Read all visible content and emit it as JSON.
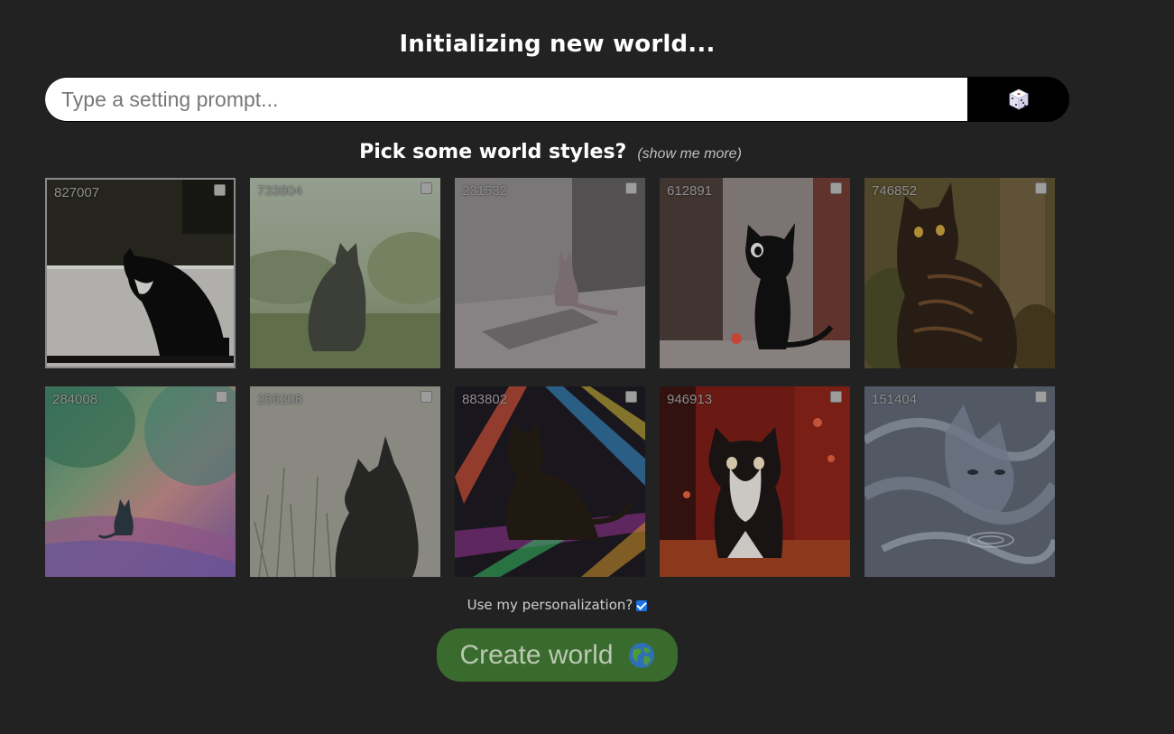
{
  "title": "Initializing new world...",
  "prompt": {
    "placeholder": "Type a setting prompt...",
    "value": ""
  },
  "styles": {
    "heading": "Pick some world styles?",
    "more_link": "(show me more)",
    "tiles": [
      {
        "id": "827007",
        "checked": false,
        "icon": "cat-silhouette-window"
      },
      {
        "id": "733804",
        "checked": false,
        "icon": "cat-meadow"
      },
      {
        "id": "231532",
        "checked": false,
        "icon": "cat-sunlit-wall"
      },
      {
        "id": "612891",
        "checked": false,
        "icon": "cat-cartoon-doorway"
      },
      {
        "id": "746852",
        "checked": false,
        "icon": "cat-forest-tabby"
      },
      {
        "id": "284008",
        "checked": false,
        "icon": "cat-rainbow-field"
      },
      {
        "id": "256208",
        "checked": false,
        "icon": "cat-grass-sketch"
      },
      {
        "id": "883802",
        "checked": false,
        "icon": "cat-neon-lights"
      },
      {
        "id": "946913",
        "checked": false,
        "icon": "cat-red-room"
      },
      {
        "id": "151404",
        "checked": false,
        "icon": "cat-smoke-swirl"
      }
    ]
  },
  "personalization": {
    "label": "Use my personalization?",
    "checked": true
  },
  "create_button": {
    "label": "Create world",
    "icon": "globe-icon"
  },
  "colors": {
    "background": "#222222",
    "create_button": "#3a6b2e",
    "checkbox_accent": "#1a73e8"
  }
}
